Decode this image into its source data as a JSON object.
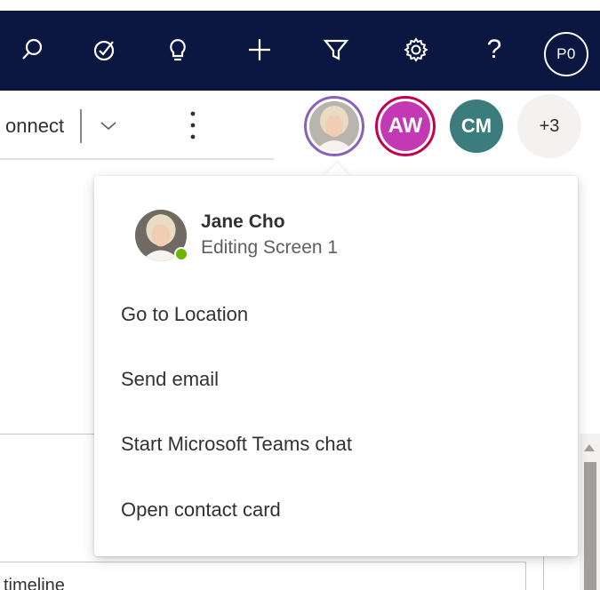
{
  "topbar": {
    "icons": [
      "search-icon",
      "task-icon",
      "lightbulb-icon",
      "plus-icon",
      "filter-icon",
      "gear-icon",
      "help-icon"
    ],
    "help_glyph": "?",
    "user_initials": "P0",
    "background_color": "#0b1741"
  },
  "command_bar": {
    "connect_label": "onnect",
    "more_glyph": "⋮"
  },
  "collaborators": {
    "aw_initials": "AW",
    "cm_initials": "CM",
    "overflow_label": "+3",
    "aw_color": "#c239b3",
    "cm_color": "#3a7d7c"
  },
  "callout": {
    "persona": {
      "name": "Jane Cho",
      "status": "Editing Screen 1",
      "presence_color": "#6bb700"
    },
    "menu": [
      {
        "label": "Go to Location"
      },
      {
        "label": "Send email"
      },
      {
        "label": "Start Microsoft Teams chat"
      },
      {
        "label": "Open contact card"
      }
    ]
  },
  "content": {
    "timeline_label": "timeline"
  }
}
